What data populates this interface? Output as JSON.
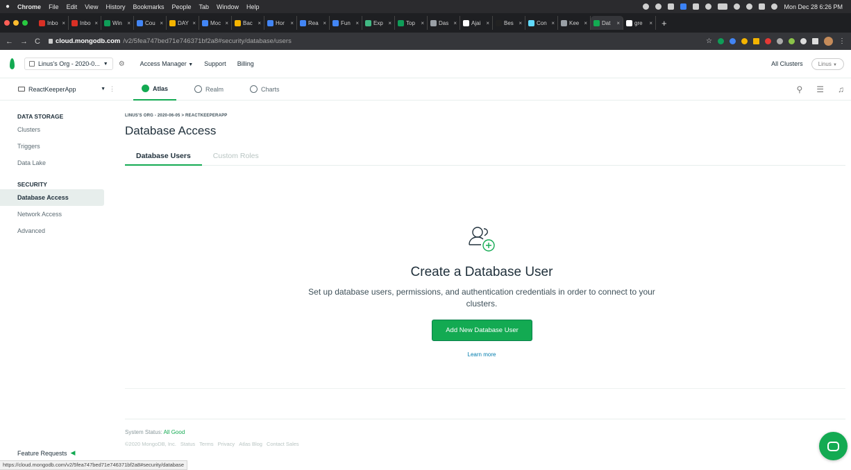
{
  "menubar": {
    "apple": "",
    "items": [
      "Chrome",
      "File",
      "Edit",
      "View",
      "History",
      "Bookmarks",
      "People",
      "Tab",
      "Window",
      "Help"
    ],
    "clock": "Mon Dec 28  6:26 PM"
  },
  "tabs": [
    {
      "label": "Inbo",
      "color": "#d93025"
    },
    {
      "label": "Inbo",
      "color": "#d93025"
    },
    {
      "label": "Win",
      "color": "#0f9d58"
    },
    {
      "label": "Cou",
      "color": "#4285f4"
    },
    {
      "label": "DAY",
      "color": "#f4b400"
    },
    {
      "label": "Moc",
      "color": "#4285f4"
    },
    {
      "label": "Bac",
      "color": "#f4b400"
    },
    {
      "label": "Hor",
      "color": "#4285f4"
    },
    {
      "label": "Rea",
      "color": "#4285f4"
    },
    {
      "label": "Fun",
      "color": "#4285f4"
    },
    {
      "label": "Exp",
      "color": "#41b883"
    },
    {
      "label": "Top",
      "color": "#0f9d58"
    },
    {
      "label": "Das",
      "color": "#9aa0a6"
    },
    {
      "label": "Ajai",
      "color": "#ffffff"
    },
    {
      "label": "Bes",
      "color": "#222222"
    },
    {
      "label": "Con",
      "color": "#61dafb"
    },
    {
      "label": "Kee",
      "color": "#9aa0a6"
    },
    {
      "label": "Dat",
      "color": "#13aa52"
    },
    {
      "label": "gre",
      "color": "#ffffff"
    }
  ],
  "tab_close": "×",
  "new_tab": "+",
  "address": {
    "host": "cloud.mongodb.com",
    "path": "/v2/5fea747bed71e746371bf2a8#security/database/users"
  },
  "topnav": {
    "org": "Linus's Org - 2020-0...",
    "access_manager": "Access Manager",
    "support": "Support",
    "billing": "Billing",
    "all_clusters": "All Clusters",
    "user": "Linus"
  },
  "projbar": {
    "project": "ReactKeeperApp",
    "tabs": [
      {
        "label": "Atlas",
        "color": "#13aa52"
      },
      {
        "label": "Realm",
        "color": "#5d6c74"
      },
      {
        "label": "Charts",
        "color": "#5d6c74"
      }
    ]
  },
  "sidebar": {
    "data_storage": "DATA STORAGE",
    "clusters": "Clusters",
    "triggers": "Triggers",
    "data_lake": "Data Lake",
    "security": "SECURITY",
    "database_access": "Database Access",
    "network_access": "Network Access",
    "advanced": "Advanced",
    "feature_requests": "Feature Requests"
  },
  "main": {
    "breadcrumb": "LINUS'S ORG - 2020-06-05 > REACTKEEPERAPP",
    "title": "Database Access",
    "tab_users": "Database Users",
    "tab_roles": "Custom Roles",
    "empty_title": "Create a Database User",
    "empty_desc": "Set up database users, permissions, and authentication credentials in order to connect to your clusters.",
    "cta": "Add New Database User",
    "learn_more": "Learn more"
  },
  "footer": {
    "status_label": "System Status:",
    "status_value": "All Good",
    "copyright": "©2020 MongoDB, Inc.",
    "links": [
      "Status",
      "Terms",
      "Privacy",
      "Atlas Blog",
      "Contact Sales"
    ]
  },
  "status_url": "https://cloud.mongodb.com/v2/5fea747bed71e746371bf2a8#security/database",
  "colors": {
    "accent": "#13aa52",
    "link": "#007cad"
  }
}
